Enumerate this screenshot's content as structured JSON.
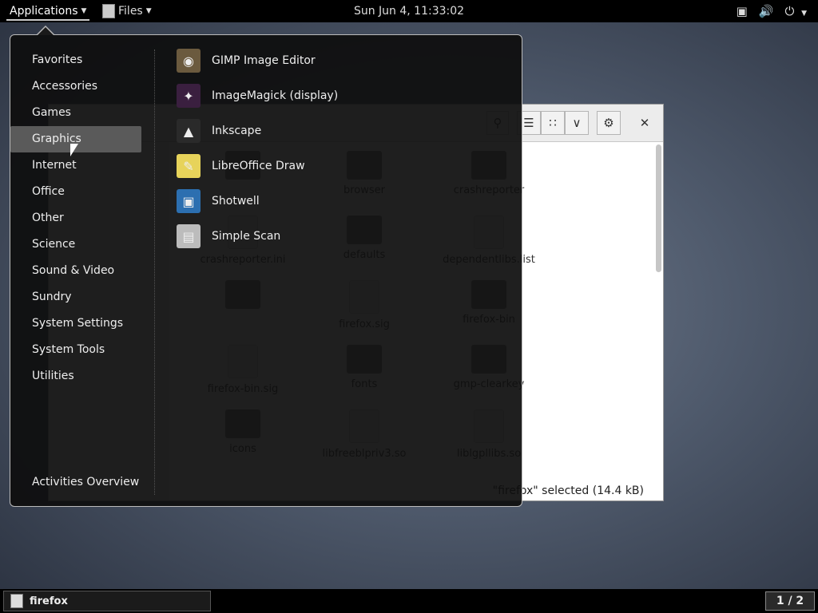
{
  "topbar": {
    "applications_label": "Applications",
    "files_label": "Files",
    "clock": "Sun Jun  4, 11:33:02",
    "tray_icons": [
      "network-icon",
      "volume-icon",
      "power-icon"
    ]
  },
  "apps_menu": {
    "categories": [
      {
        "label": "Favorites"
      },
      {
        "label": "Accessories"
      },
      {
        "label": "Games"
      },
      {
        "label": "Graphics",
        "selected": true
      },
      {
        "label": "Internet"
      },
      {
        "label": "Office"
      },
      {
        "label": "Other"
      },
      {
        "label": "Science"
      },
      {
        "label": "Sound & Video"
      },
      {
        "label": "Sundry"
      },
      {
        "label": "System Settings"
      },
      {
        "label": "System Tools"
      },
      {
        "label": "Utilities"
      }
    ],
    "activities_label": "Activities Overview",
    "apps": [
      {
        "label": "GIMP Image Editor",
        "icon": "gimp-icon"
      },
      {
        "label": "ImageMagick (display)",
        "icon": "imagemagick-icon"
      },
      {
        "label": "Inkscape",
        "icon": "inkscape-icon"
      },
      {
        "label": "LibreOffice Draw",
        "icon": "libreoffice-draw-icon"
      },
      {
        "label": "Shotwell",
        "icon": "shotwell-icon"
      },
      {
        "label": "Simple Scan",
        "icon": "scanner-icon"
      }
    ]
  },
  "file_manager": {
    "items": [
      "",
      "browser",
      "crashreporter",
      "crashreporter.ini",
      "defaults",
      "dependentlibs.list",
      "",
      "firefox.sig",
      "firefox-bin",
      "firefox-bin.sig",
      "fonts",
      "gmp-clearkey",
      "icons",
      "libfreeblpriv3.so",
      "liblgpllibs.so"
    ],
    "status": "\"firefox\" selected  (14.4 kB)"
  },
  "bottombar": {
    "task_label": "firefox",
    "workspace": "1 / 2"
  },
  "colors": {
    "menu_bg": "#0e0e0e",
    "selected_bg": "#5a5a5a",
    "topbar_bg": "#000000"
  }
}
